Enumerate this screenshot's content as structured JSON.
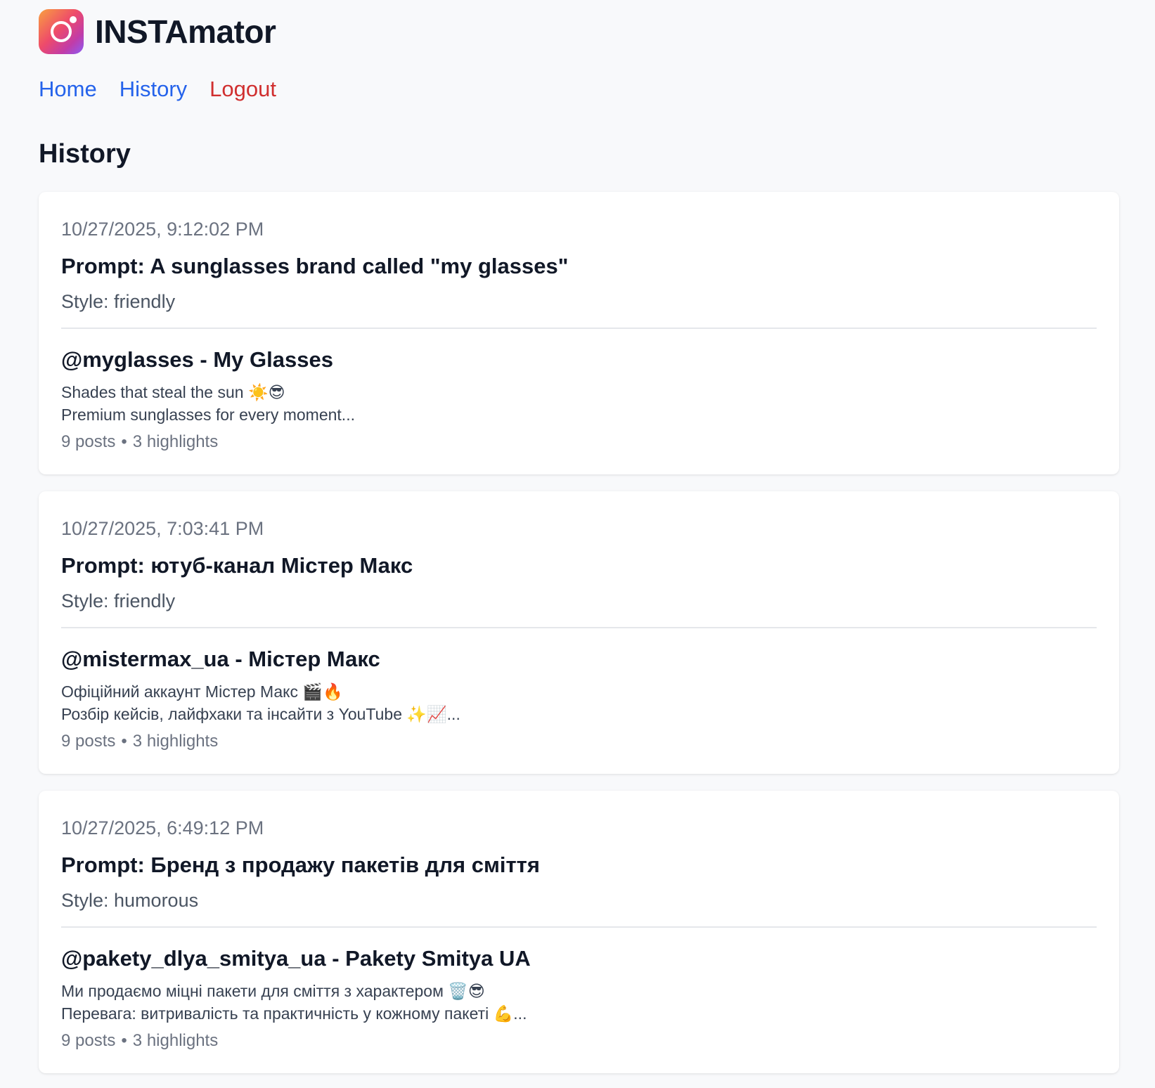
{
  "app": {
    "name": "INSTAmator",
    "logo_icon": "instagram-camera-icon"
  },
  "nav": {
    "home": "Home",
    "history": "History",
    "logout": "Logout",
    "link_color": "#2563eb",
    "logout_color": "#d02f2f"
  },
  "page": {
    "title": "History"
  },
  "entries": [
    {
      "timestamp": "10/27/2025, 9:12:02 PM",
      "prompt": "Prompt: A sunglasses brand called \"my glasses\"",
      "style": "Style: friendly",
      "account": "@myglasses - My Glasses",
      "bio_line1": "Shades that steal the sun ☀️😎",
      "bio_line2": "Premium sunglasses for every moment...",
      "posts": "9 posts",
      "separator": "•",
      "highlights": "3 highlights"
    },
    {
      "timestamp": "10/27/2025, 7:03:41 PM",
      "prompt": "Prompt: ютуб-канал Містер Макс",
      "style": "Style: friendly",
      "account": "@mistermax_ua - Містер Макс",
      "bio_line1": "Офіційний аккаунт Містер Макс 🎬🔥",
      "bio_line2": "Розбір кейсів, лайфхаки та інсайти з YouTube ✨📈...",
      "posts": "9 posts",
      "separator": "•",
      "highlights": "3 highlights"
    },
    {
      "timestamp": "10/27/2025, 6:49:12 PM",
      "prompt": "Prompt: Бренд з продажу пакетів для сміття",
      "style": "Style: humorous",
      "account": "@pakety_dlya_smitya_ua - Pakety Smitya UA",
      "bio_line1": "Ми продаємо міцні пакети для сміття з характером 🗑️😎",
      "bio_line2": "Перевага: витривалість та практичність у кожному пакеті 💪...",
      "posts": "9 posts",
      "separator": "•",
      "highlights": "3 highlights"
    }
  ]
}
